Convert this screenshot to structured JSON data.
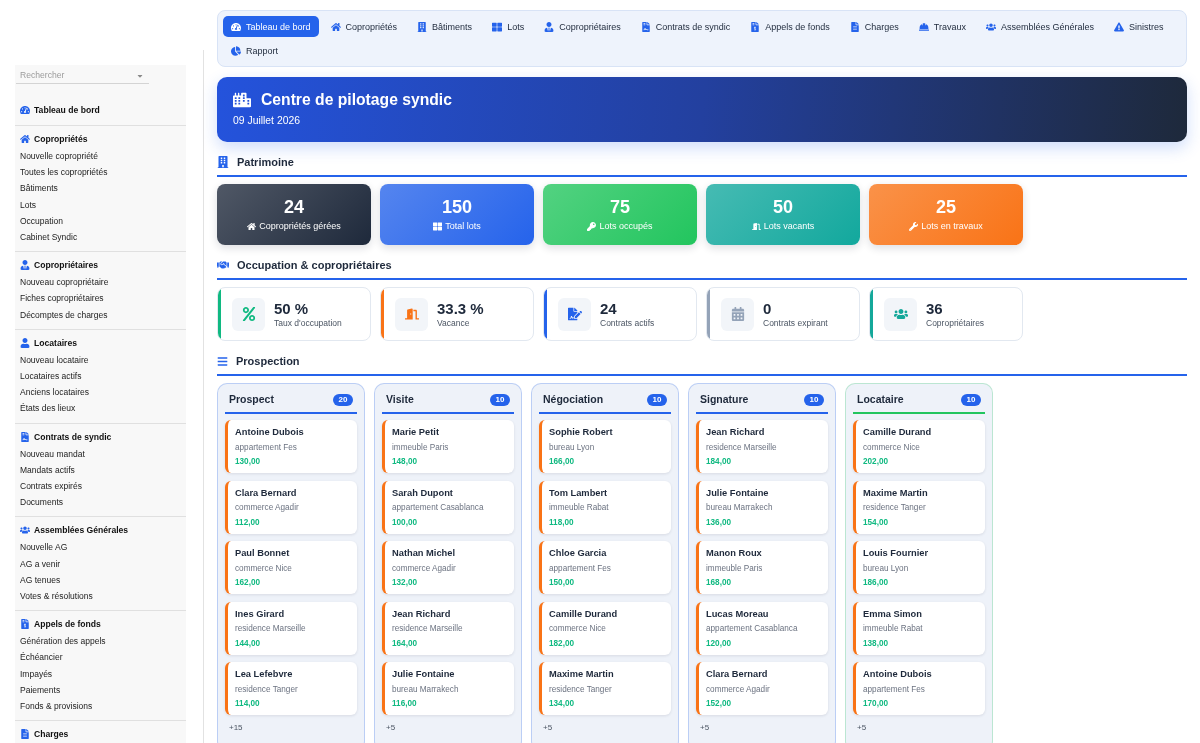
{
  "sidebar": {
    "search": {
      "placeholder": "Rechercher"
    },
    "sections": [
      {
        "title": "Tableau de bord"
      },
      {
        "title": "Copropriétés",
        "items": [
          "Nouvelle copropriété",
          "Toutes les copropriétés",
          "Bâtiments",
          "Lots",
          "Occupation",
          "Cabinet Syndic"
        ]
      },
      {
        "title": "Copropriétaires",
        "items": [
          "Nouveau copropriétaire",
          "Fiches copropriétaires",
          "Décomptes de charges"
        ]
      },
      {
        "title": "Locataires",
        "items": [
          "Nouveau locataire",
          "Locataires actifs",
          "Anciens locataires",
          "États des lieux"
        ]
      },
      {
        "title": "Contrats de syndic",
        "items": [
          "Nouveau mandat",
          "Mandats actifs",
          "Contrats expirés",
          "Documents"
        ]
      },
      {
        "title": "Assemblées Générales",
        "items": [
          "Nouvelle AG",
          "AG a venir",
          "AG tenues",
          "Votes & résolutions"
        ]
      },
      {
        "title": "Appels de fonds",
        "items": [
          "Génération des appels",
          "Échéancier",
          "Impayés",
          "Paiements",
          "Fonds & provisions"
        ]
      },
      {
        "title": "Charges"
      }
    ]
  },
  "nav": {
    "tabs": [
      {
        "label": "Tableau de bord",
        "selected": true
      },
      {
        "label": "Copropriétés",
        "selected": false
      },
      {
        "label": "Bâtiments",
        "selected": false
      },
      {
        "label": "Lots",
        "selected": false
      },
      {
        "label": "Copropriétaires",
        "selected": false
      },
      {
        "label": "Contrats de syndic",
        "selected": false
      },
      {
        "label": "Appels de fonds",
        "selected": false
      },
      {
        "label": "Charges",
        "selected": false
      },
      {
        "label": "Travaux",
        "selected": false
      },
      {
        "label": "Assemblées Générales",
        "selected": false
      },
      {
        "label": "Sinistres",
        "selected": false
      },
      {
        "label": "Rapport",
        "selected": false
      }
    ]
  },
  "banner": {
    "title": "Centre de pilotage syndic",
    "date": "09 Juillet 2026"
  },
  "patrimoine": {
    "title": "Patrimoine",
    "stats": [
      {
        "value": "24",
        "label": "Copropriétés gérées",
        "color": "#1e293b"
      },
      {
        "value": "150",
        "label": "Total lots",
        "color": "#2563eb"
      },
      {
        "value": "75",
        "label": "Lots occupés",
        "color": "#22c55e"
      },
      {
        "value": "50",
        "label": "Lots vacants",
        "color": "#12a89d"
      },
      {
        "value": "25",
        "label": "Lots en travaux",
        "color": "#f97316"
      }
    ]
  },
  "occupation": {
    "title": "Occupation & copropriétaires",
    "kpis": [
      {
        "value": "50 %",
        "label": "Taux d'occupation",
        "color": "#10b981"
      },
      {
        "value": "33.3 %",
        "label": "Vacance",
        "color": "#f97316"
      },
      {
        "value": "24",
        "label": "Contrats actifs",
        "color": "#2563eb"
      },
      {
        "value": "0",
        "label": "Contrats expirant",
        "color": "#94a3b8"
      },
      {
        "value": "36",
        "label": "Copropriétaires",
        "color": "#14a89a"
      }
    ]
  },
  "prospection": {
    "title": "Prospection",
    "columns": [
      {
        "title": "Prospect",
        "count": "20",
        "color": "#2563eb",
        "cards": [
          {
            "name": "Antoine Dubois",
            "detail": "appartement Fes",
            "amount": "130,00"
          },
          {
            "name": "Clara Bernard",
            "detail": "commerce Agadir",
            "amount": "112,00"
          },
          {
            "name": "Paul Bonnet",
            "detail": "commerce Nice",
            "amount": "162,00"
          },
          {
            "name": "Ines Girard",
            "detail": "residence Marseille",
            "amount": "144,00"
          },
          {
            "name": "Lea Lefebvre",
            "detail": "residence Tanger",
            "amount": "114,00"
          }
        ],
        "more": "+15"
      },
      {
        "title": "Visite",
        "count": "10",
        "color": "#2563eb",
        "cards": [
          {
            "name": "Marie Petit",
            "detail": "immeuble Paris",
            "amount": "148,00"
          },
          {
            "name": "Sarah Dupont",
            "detail": "appartement Casablanca",
            "amount": "100,00"
          },
          {
            "name": "Nathan Michel",
            "detail": "commerce Agadir",
            "amount": "132,00"
          },
          {
            "name": "Jean Richard",
            "detail": "residence Marseille",
            "amount": "164,00"
          },
          {
            "name": "Julie Fontaine",
            "detail": "bureau Marrakech",
            "amount": "116,00"
          }
        ],
        "more": "+5"
      },
      {
        "title": "Négociation",
        "count": "10",
        "color": "#2563eb",
        "cards": [
          {
            "name": "Sophie Robert",
            "detail": "bureau Lyon",
            "amount": "166,00"
          },
          {
            "name": "Tom Lambert",
            "detail": "immeuble Rabat",
            "amount": "118,00"
          },
          {
            "name": "Chloe Garcia",
            "detail": "appartement Fes",
            "amount": "150,00"
          },
          {
            "name": "Camille Durand",
            "detail": "commerce Nice",
            "amount": "182,00"
          },
          {
            "name": "Maxime Martin",
            "detail": "residence Tanger",
            "amount": "134,00"
          }
        ],
        "more": "+5"
      },
      {
        "title": "Signature",
        "count": "10",
        "color": "#2563eb",
        "cards": [
          {
            "name": "Jean Richard",
            "detail": "residence Marseille",
            "amount": "184,00"
          },
          {
            "name": "Julie Fontaine",
            "detail": "bureau Marrakech",
            "amount": "136,00"
          },
          {
            "name": "Manon Roux",
            "detail": "immeuble Paris",
            "amount": "168,00"
          },
          {
            "name": "Lucas Moreau",
            "detail": "appartement Casablanca",
            "amount": "120,00"
          },
          {
            "name": "Clara Bernard",
            "detail": "commerce Agadir",
            "amount": "152,00"
          }
        ],
        "more": "+5"
      },
      {
        "title": "Locataire",
        "count": "10",
        "color": "#22c55e",
        "cards": [
          {
            "name": "Camille Durand",
            "detail": "commerce Nice",
            "amount": "202,00"
          },
          {
            "name": "Maxime Martin",
            "detail": "residence Tanger",
            "amount": "154,00"
          },
          {
            "name": "Louis Fournier",
            "detail": "bureau Lyon",
            "amount": "186,00"
          },
          {
            "name": "Emma Simon",
            "detail": "immeuble Rabat",
            "amount": "138,00"
          },
          {
            "name": "Antoine Dubois",
            "detail": "appartement Fes",
            "amount": "170,00"
          }
        ],
        "more": "+5"
      }
    ]
  }
}
